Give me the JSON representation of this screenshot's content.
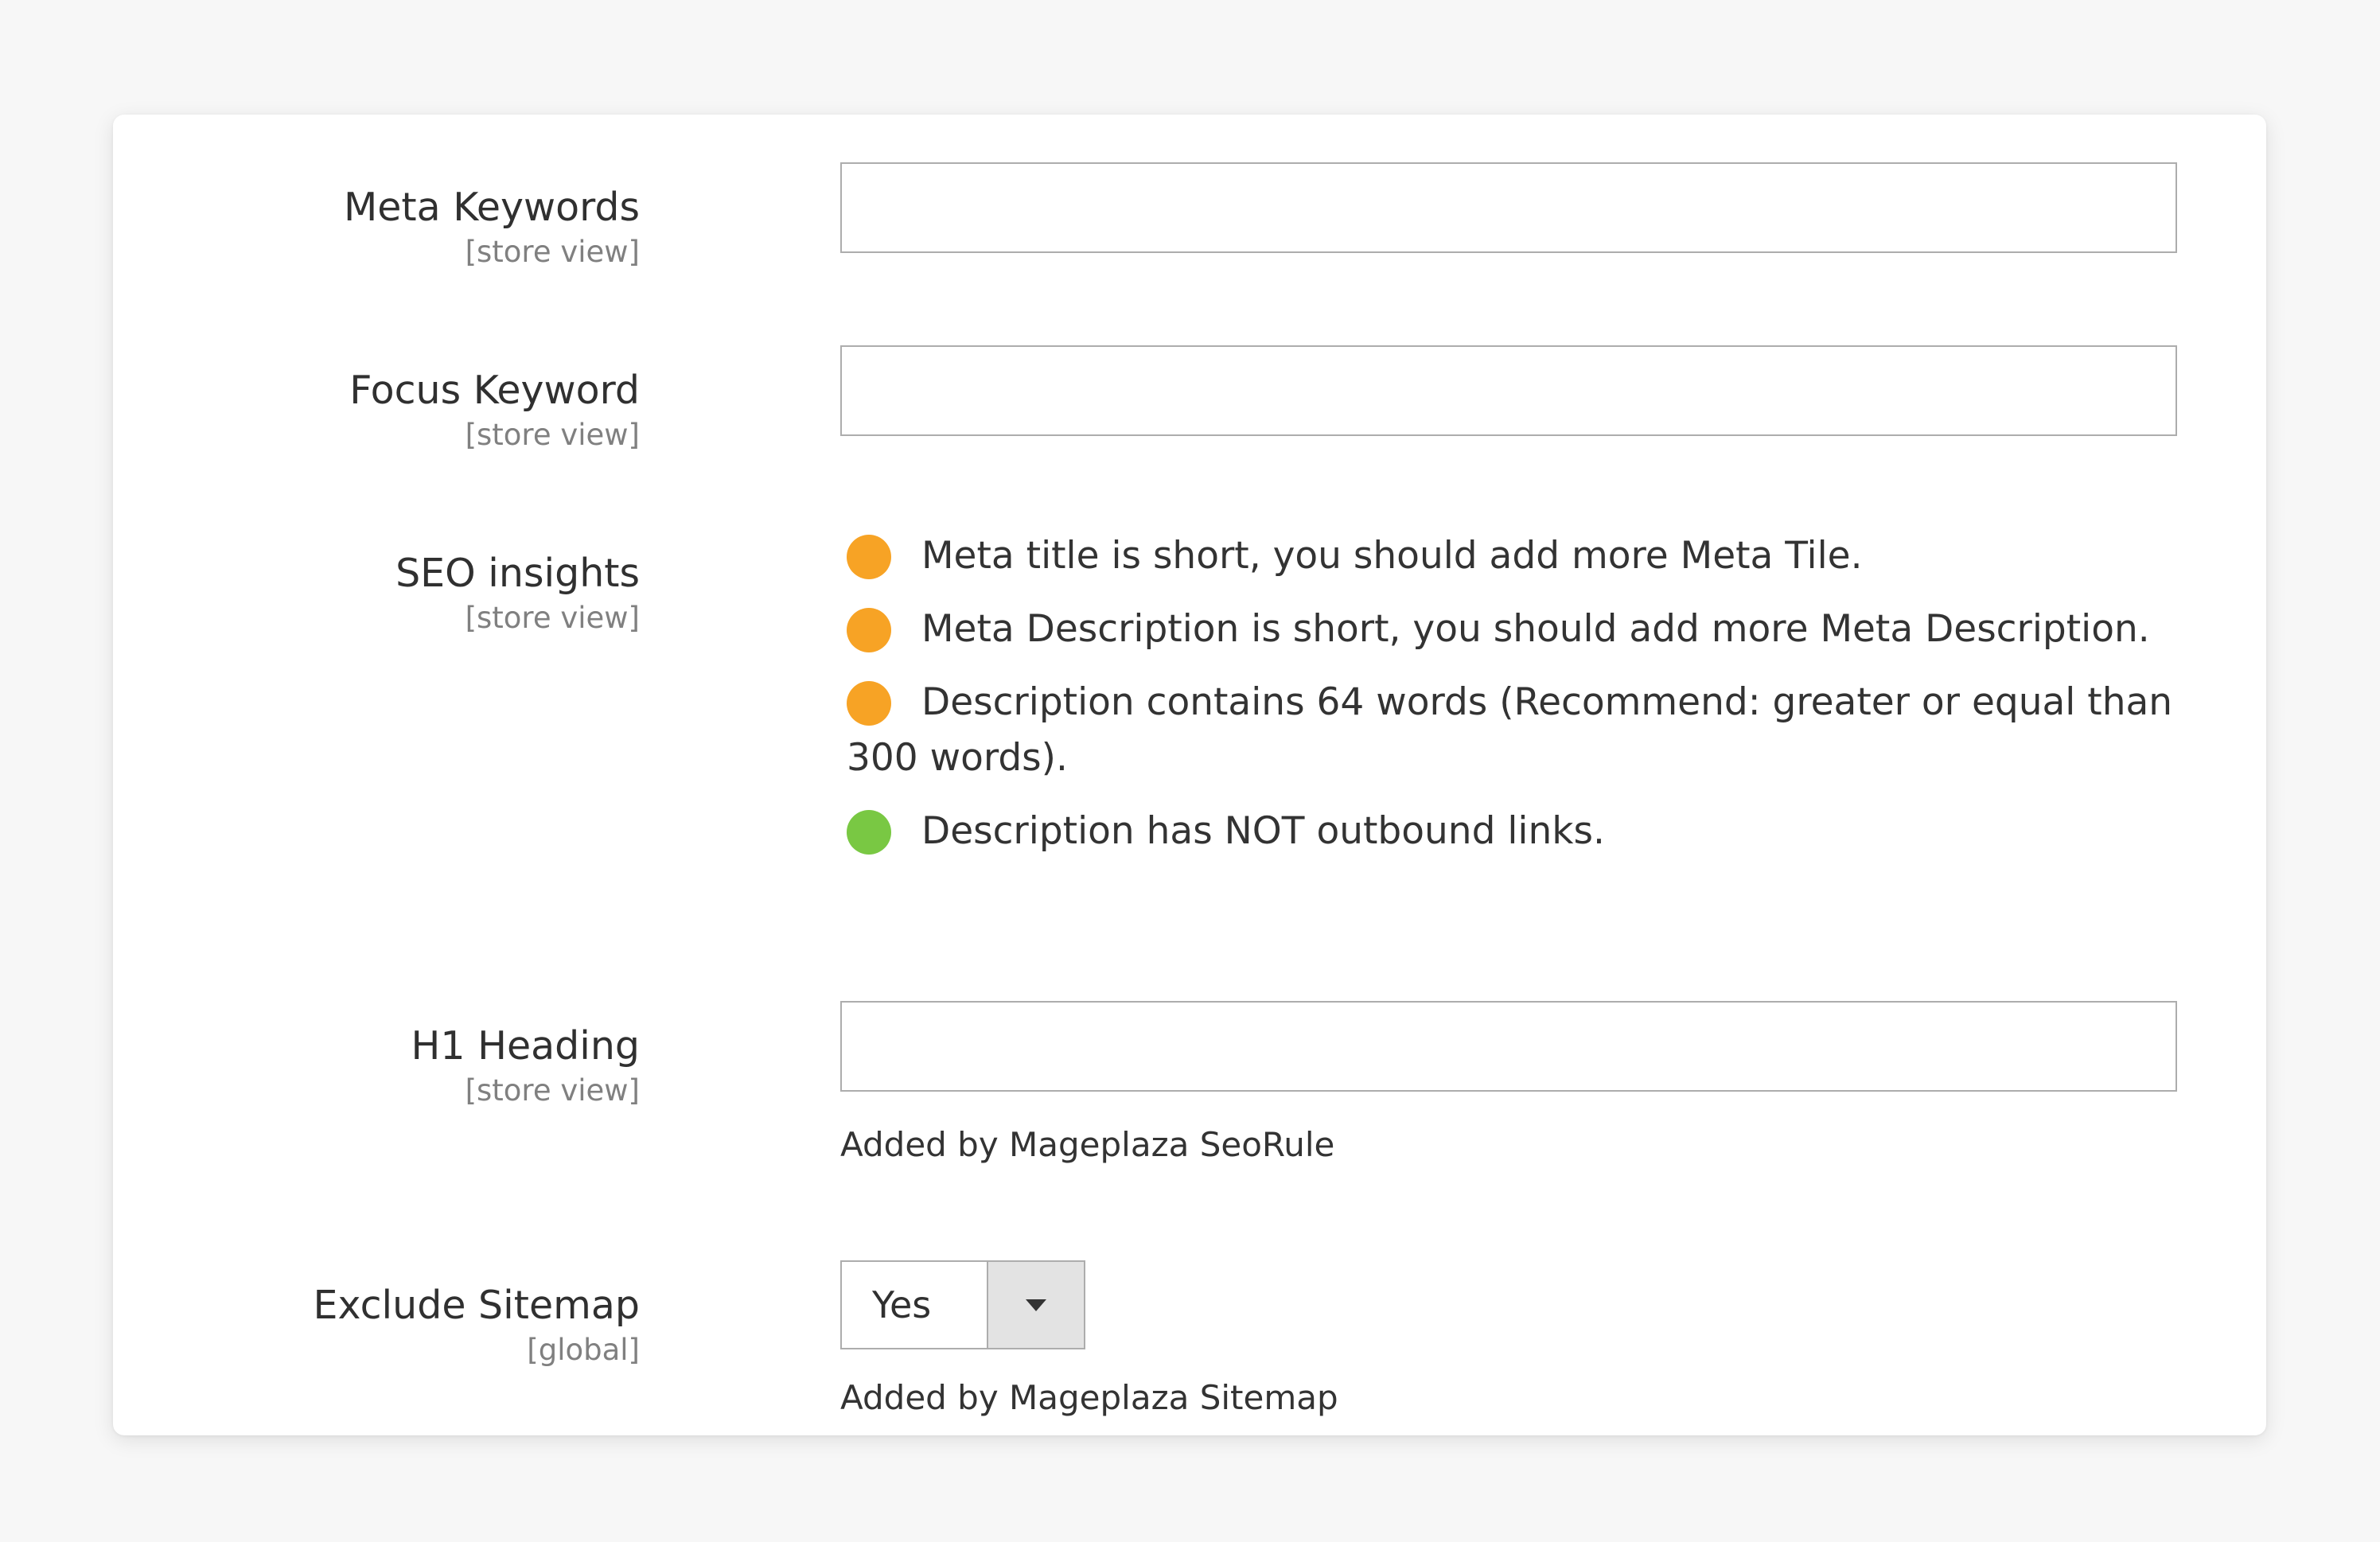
{
  "colors": {
    "warning": "#f7a325",
    "success": "#79c843"
  },
  "fields": {
    "meta_keywords": {
      "label": "Meta Keywords",
      "scope": "[store view]",
      "value": ""
    },
    "focus_keyword": {
      "label": "Focus Keyword",
      "scope": "[store view]",
      "value": ""
    },
    "seo_insights": {
      "label": "SEO insights",
      "scope": "[store view]",
      "items": [
        {
          "status": "warning",
          "icon": "orange-circle-icon",
          "text": "Meta title is short, you should add more Meta Tile."
        },
        {
          "status": "warning",
          "icon": "orange-circle-icon",
          "text": "Meta Description is short, you should add more Meta Description."
        },
        {
          "status": "warning",
          "icon": "orange-circle-icon",
          "text": "Description contains 64 words (Recommend: greater or equal than 300 words)."
        },
        {
          "status": "success",
          "icon": "green-circle-icon",
          "text": "Description has NOT outbound links."
        }
      ]
    },
    "h1_heading": {
      "label": "H1 Heading",
      "scope": "[store view]",
      "value": "",
      "note": "Added by Mageplaza SeoRule"
    },
    "exclude_sitemap": {
      "label": "Exclude Sitemap",
      "scope": "[global]",
      "selected": "Yes",
      "icon": "chevron-down-icon",
      "note": "Added by Mageplaza Sitemap"
    }
  }
}
